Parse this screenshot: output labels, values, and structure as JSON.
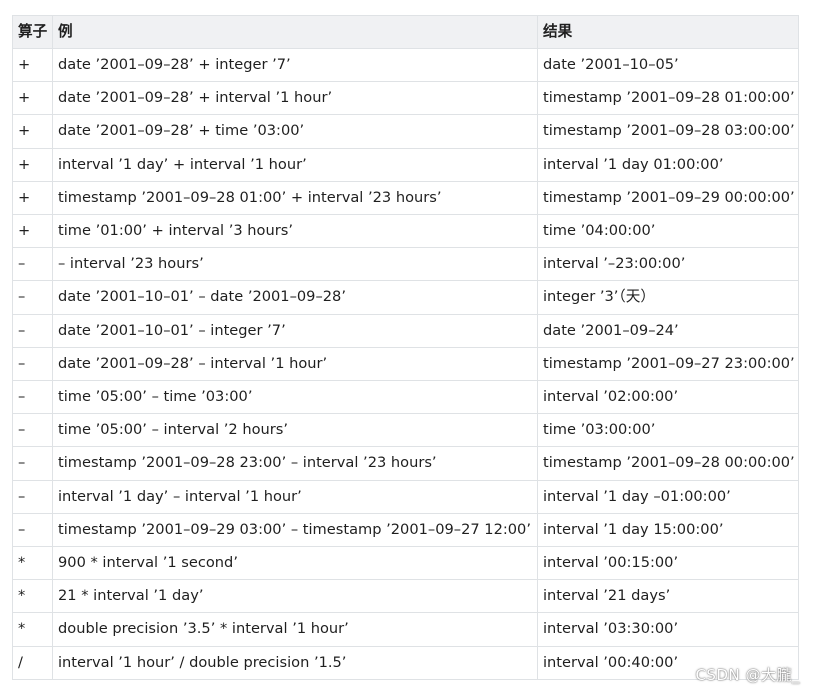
{
  "table": {
    "headers": [
      "算子",
      "例",
      "结果"
    ],
    "rows": [
      [
        "+",
        "date ’2001–09–28’ + integer ’7’",
        "date ’2001–10–05’"
      ],
      [
        "+",
        "date ’2001–09–28’ + interval ’1 hour’",
        "timestamp ’2001–09–28 01:00:00’"
      ],
      [
        "+",
        "date ’2001–09–28’ + time ’03:00’",
        "timestamp ’2001–09–28 03:00:00’"
      ],
      [
        "+",
        "interval ’1 day’ + interval ’1 hour’",
        "interval ’1 day 01:00:00’"
      ],
      [
        "+",
        "timestamp ’2001–09–28 01:00’ + interval ’23 hours’",
        "timestamp ’2001–09–29 00:00:00’"
      ],
      [
        "+",
        "time ’01:00’ + interval ’3 hours’",
        "time ’04:00:00’"
      ],
      [
        "–",
        "– interval ’23 hours’",
        "interval ’–23:00:00’"
      ],
      [
        "–",
        "date ’2001–10–01’ – date ’2001–09–28’",
        "integer ’3’（天）"
      ],
      [
        "–",
        "date ’2001–10–01’ – integer ’7’",
        "date ’2001–09–24’"
      ],
      [
        "–",
        "date ’2001–09–28’ – interval ’1 hour’",
        "timestamp ’2001–09–27 23:00:00’"
      ],
      [
        "–",
        "time ’05:00’ – time ’03:00’",
        "interval ’02:00:00’"
      ],
      [
        "–",
        "time ’05:00’ – interval ’2 hours’",
        "time ’03:00:00’"
      ],
      [
        "–",
        "timestamp ’2001–09–28 23:00’ – interval ’23 hours’",
        "timestamp ’2001–09–28 00:00:00’"
      ],
      [
        "–",
        "interval ’1 day’ – interval ’1 hour’",
        "interval ’1 day –01:00:00’"
      ],
      [
        "–",
        "timestamp ’2001–09–29 03:00’ – timestamp ’2001–09–27 12:00’",
        "interval ’1 day 15:00:00’"
      ],
      [
        "*",
        "900 * interval ’1 second’",
        "interval ’00:15:00’"
      ],
      [
        "*",
        "21 * interval ’1 day’",
        "interval ’21 days’"
      ],
      [
        "*",
        "double precision ’3.5’ * interval ’1 hour’",
        "interval ’03:30:00’"
      ],
      [
        "/",
        "interval ’1 hour’ / double precision ’1.5’",
        "interval ’00:40:00’"
      ]
    ]
  },
  "watermark": "CSDN @大朧_"
}
